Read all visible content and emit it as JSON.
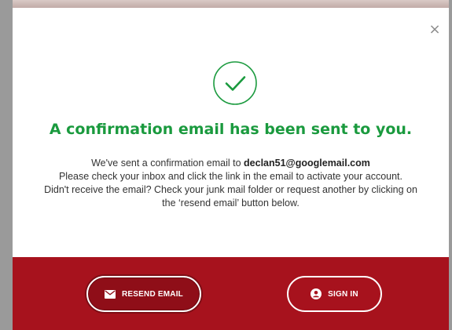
{
  "modal": {
    "close_glyph": "×",
    "title": "A confirmation email has been sent to you.",
    "body": {
      "line1_prefix": "We've sent a confirmation email to ",
      "email": "declan51@googlemail.com",
      "line2": "Please check your inbox and click the link in the email to activate your account.",
      "line3": "Didn't receive the email? Check your junk mail folder or request another by clicking on the ‘resend email’ button below."
    }
  },
  "footer": {
    "resend_label": "RESEND EMAIL",
    "signin_label": "SIGN IN"
  },
  "colors": {
    "title_green": "#1a9a3e",
    "footer_red": "#a7121d"
  }
}
